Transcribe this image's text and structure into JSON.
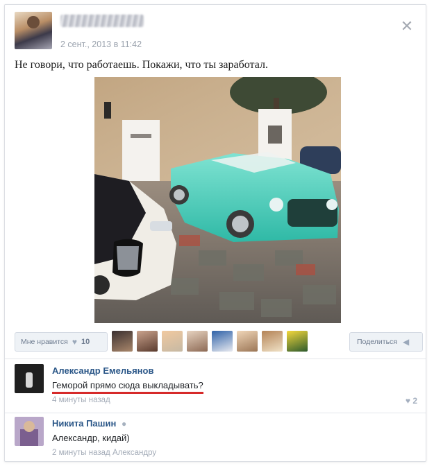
{
  "post": {
    "date": "2 сент., 2013 в 11:42",
    "text": "Не говори, что работаешь. Покажи, что ты заработал.",
    "close_icon": "close-icon"
  },
  "actions": {
    "like_label": "Мне нравится",
    "like_count": "10",
    "share_label": "Поделиться",
    "heart_icon": "♥",
    "share_icon": "◀"
  },
  "likers": [
    {
      "name": "liker-avatar-1",
      "colors": [
        "#3b3030",
        "#a9876b"
      ]
    },
    {
      "name": "liker-avatar-2",
      "colors": [
        "#caa38d",
        "#5a3b2e"
      ]
    },
    {
      "name": "liker-avatar-3",
      "colors": [
        "#f1c99f",
        "#c6b9a4"
      ]
    },
    {
      "name": "liker-avatar-4",
      "colors": [
        "#e7d3c0",
        "#8d6a55"
      ]
    },
    {
      "name": "liker-avatar-5",
      "colors": [
        "#2f62a8",
        "#e7e9ef"
      ]
    },
    {
      "name": "liker-avatar-6",
      "colors": [
        "#f0d6b8",
        "#9b7656"
      ]
    },
    {
      "name": "liker-avatar-7",
      "colors": [
        "#b48356",
        "#efe1c6"
      ]
    },
    {
      "name": "liker-avatar-8",
      "colors": [
        "#f4d83c",
        "#2d5b2d"
      ]
    }
  ],
  "comments": [
    {
      "author": "Александр Емельянов",
      "text": "Геморой прямо сюда выкладывать?",
      "time": "4 минуты назад",
      "likes": "2"
    },
    {
      "author": "Никита Пашин",
      "online": "●",
      "text": "Александр, кидай)",
      "time": "2 минуты назад Александру"
    }
  ],
  "colors": {
    "link": "#2b5788",
    "meta": "#a4acb8",
    "underline": "#d62a2a"
  }
}
